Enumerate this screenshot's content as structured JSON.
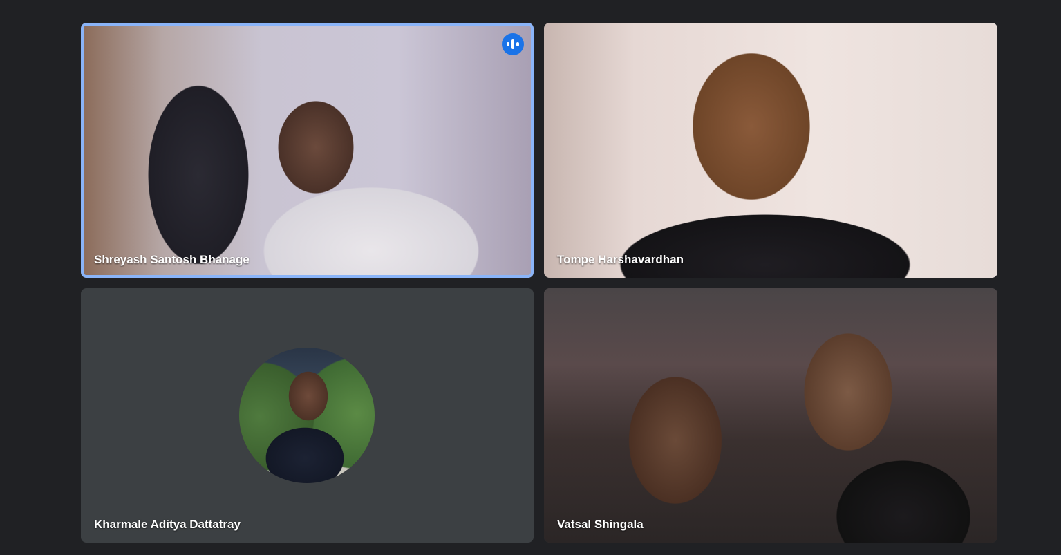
{
  "participants": [
    {
      "name": "Shreyash Santosh Bhanage",
      "speaking": true,
      "video": true
    },
    {
      "name": "Tompe Harshavardhan",
      "speaking": false,
      "video": true
    },
    {
      "name": "Kharmale Aditya Dattatray",
      "speaking": false,
      "video": false
    },
    {
      "name": "Vatsal Shingala",
      "speaking": false,
      "video": true
    }
  ],
  "indicators": {
    "audio_icon": "audio-level-icon",
    "speaking_color": "#8ab4f8",
    "audio_badge_color": "#1a73e8"
  },
  "colors": {
    "background": "#202124",
    "tile_no_video": "#3c4043"
  }
}
